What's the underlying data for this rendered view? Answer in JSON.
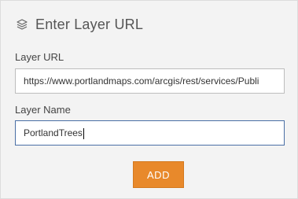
{
  "header": {
    "icon": "layers-icon",
    "title": "Enter Layer URL"
  },
  "form": {
    "url_label": "Layer URL",
    "url_value": "https://www.portlandmaps.com/arcgis/rest/services/Publi",
    "name_label": "Layer Name",
    "name_value": "PortlandTrees"
  },
  "actions": {
    "add_label": "ADD"
  },
  "colors": {
    "accent": "#e8892b",
    "panel_bg": "#f3f3f3",
    "focus_border": "#4a6fa5"
  }
}
